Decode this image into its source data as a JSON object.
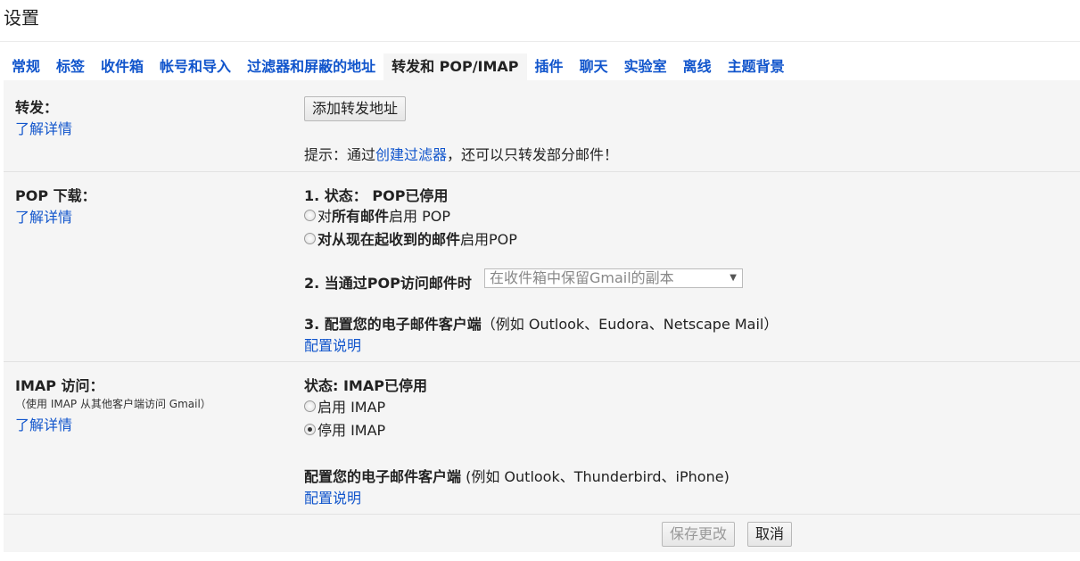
{
  "page": {
    "title": "设置"
  },
  "tabs": [
    {
      "label": "常规"
    },
    {
      "label": "标签"
    },
    {
      "label": "收件箱"
    },
    {
      "label": "帐号和导入"
    },
    {
      "label": "过滤器和屏蔽的地址"
    },
    {
      "label": "转发和 POP/IMAP",
      "active": true
    },
    {
      "label": "插件"
    },
    {
      "label": "聊天"
    },
    {
      "label": "实验室"
    },
    {
      "label": "离线"
    },
    {
      "label": "主题背景"
    }
  ],
  "forwarding": {
    "title": "转发：",
    "learn_more": "了解详情",
    "add_button": "添加转发地址",
    "tip_prefix": "提示：通过",
    "tip_link": "创建过滤器",
    "tip_suffix": "，还可以只转发部分邮件！"
  },
  "pop": {
    "title": "POP 下载：",
    "learn_more": "了解详情",
    "status_label": "1. 状态：",
    "status_value": "POP已停用",
    "option_all_prefix": "对",
    "option_all_bold": "所有邮件",
    "option_all_suffix": "启用 POP",
    "option_new_bold": "对从现在起收到的邮件",
    "option_new_suffix": "启用POP",
    "when_label": "2. 当通过POP访问邮件时",
    "when_select_value": "在收件箱中保留Gmail的副本",
    "configure_label": "3. 配置您的电子邮件客户端",
    "configure_examples": "（例如 Outlook、Eudora、Netscape Mail）",
    "configure_link": "配置说明"
  },
  "imap": {
    "title": "IMAP 访问：",
    "note": "（使用 IMAP 从其他客户端访问 Gmail）",
    "learn_more": "了解详情",
    "status": "状态: IMAP已停用",
    "option_enable": "启用 IMAP",
    "option_disable": "停用 IMAP",
    "selected": "disable",
    "configure_label": "配置您的电子邮件客户端",
    "configure_examples": " (例如 Outlook、Thunderbird、iPhone)",
    "configure_link": "配置说明"
  },
  "actions": {
    "save": "保存更改",
    "save_enabled": false,
    "cancel": "取消"
  }
}
